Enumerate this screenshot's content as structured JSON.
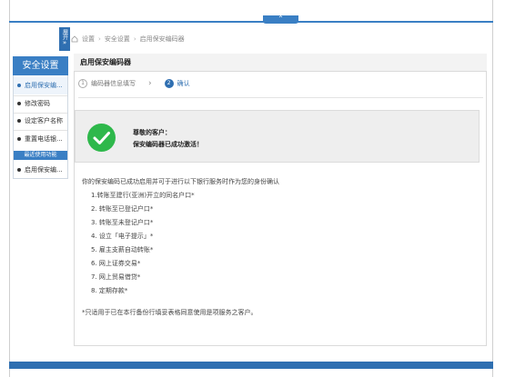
{
  "top_tab": {
    "chevron": "⌃"
  },
  "expand_tab": {
    "label": "展开",
    "arrows": "»"
  },
  "breadcrumb": [
    "设置",
    "安全设置",
    "启用保安编码器"
  ],
  "breadcrumb_sep": "›",
  "sidebar": {
    "title": "安全设置",
    "items": [
      {
        "label": "启用保安编..."
      },
      {
        "label": "修改密码"
      },
      {
        "label": "设定客户名称"
      },
      {
        "label": "重置电话银..."
      }
    ],
    "recent_header": "最近使用功能",
    "recent_items": [
      {
        "label": "启用保安编..."
      }
    ]
  },
  "panel": {
    "title": "启用保安编码器",
    "steps": [
      {
        "number": "1",
        "label": "编码器信息填写"
      },
      {
        "number": "2",
        "label": "确认"
      }
    ],
    "step_arrow": "›",
    "success": {
      "greeting": "尊敬的客户：",
      "message": "保安编码器已成功激活！"
    },
    "intro": "你的保安编码已成功启用并可于进行以下银行服务时作为您的身份确认",
    "services": [
      "1.转账至建行(亚洲)开立的同名户口*",
      "2. 转账至已登记户口*",
      "3. 转账至未登记户口*",
      "4. 设立「电子提示」*",
      "5. 雇主支薪自动转账*",
      "6. 网上证券交易*",
      "7. 网上贸易借贷*",
      "8. 定期存款*"
    ],
    "footnote": "*只适用于已在本行备份行填妥表格同意使用是项服务之客户。"
  },
  "colors": {
    "primary": "#3a7fc4",
    "success": "#2eb84b"
  }
}
